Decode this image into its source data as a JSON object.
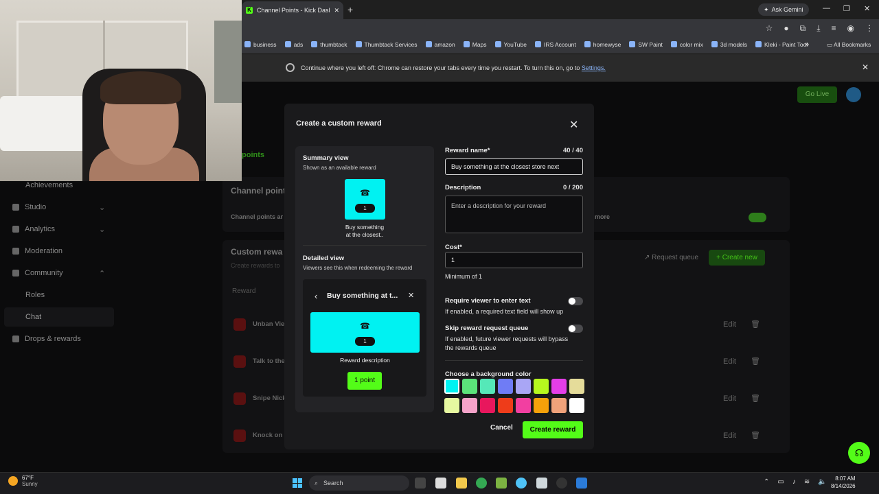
{
  "browser": {
    "tab_title": "Channel Points - Kick Dashboard",
    "new_tab": "+",
    "ask_gemini": "Ask Gemini",
    "bookmarks": [
      "business",
      "ads",
      "thumbtack",
      "Thumbtack Services",
      "amazon",
      "Maps",
      "YouTube",
      "IRS Account",
      "homewyse",
      "SW Paint",
      "color mix",
      "3d models",
      "Kleki - Paint Tool"
    ],
    "bookmarks_more": "»",
    "all_bookmarks": "All Bookmarks",
    "restore_text": "Continue where you left off: Chrome can restore your tabs every time you restart. To turn this on, go to",
    "restore_link": "Settings."
  },
  "dashboard": {
    "go_live": "Go Live",
    "points_tab": "points",
    "nav": [
      "Achievements",
      "Studio",
      "Analytics",
      "Moderation",
      "Community",
      "Roles",
      "Chat",
      "Drops & rewards"
    ],
    "channel_points_heading": "Channel point",
    "channel_points_desc": "Channel points ar",
    "more_link": "more",
    "custom_rewards_heading": "Custom rewa",
    "custom_rewards_desc": "Create rewards to",
    "request_queue": "Request queue",
    "create_new": "Create new",
    "col_reward": "Reward",
    "rows": [
      "Unban Vie",
      "Talk to the",
      "Snipe Nick",
      "Knock on I"
    ],
    "edit_label": "Edit"
  },
  "modal": {
    "title": "Create a custom reward",
    "summary_title": "Summary view",
    "summary_sub": "Shown as an available reward",
    "summary_cost": "1",
    "summary_name_1": "Buy something",
    "summary_name_2": "at the closest..",
    "detailed_title": "Detailed view",
    "detailed_sub": "Viewers see this when redeeming the reward",
    "detail_header": "Buy something at t...",
    "detail_cost": "1",
    "reward_description": "Reward description",
    "points_button": "1 point",
    "reward_name_label": "Reward name*",
    "reward_name_count": "40 / 40",
    "reward_name_value": "Buy something at the closest store next",
    "description_label": "Description",
    "description_count": "0 / 200",
    "description_placeholder": "Enter a description for your reward",
    "cost_label": "Cost*",
    "cost_value": "1",
    "cost_min": "Minimum of 1",
    "require_text_label": "Require viewer to enter text",
    "require_text_hint": "If enabled, a required text field will show up",
    "skip_queue_label": "Skip reward request queue",
    "skip_queue_hint_1": "If enabled, future viewer requests will bypass",
    "skip_queue_hint_2": "the rewards queue",
    "color_label": "Choose a background color",
    "colors_row1": [
      "#00f2f2",
      "#5be37a",
      "#55e8b8",
      "#6f7cf5",
      "#a9a6f5",
      "#b6f71e",
      "#e43ee8",
      "#e5dc9a"
    ],
    "colors_row2": [
      "#e6f8a0",
      "#f4a3c9",
      "#e8175d",
      "#ee3c1a",
      "#f23fa1",
      "#f5a10a",
      "#f0a27a",
      "#ffffff"
    ],
    "cancel": "Cancel",
    "create": "Create reward"
  },
  "taskbar": {
    "temp": "67°F",
    "condition": "Sunny",
    "search": "Search",
    "time": "8:07 AM",
    "date": "8/14/2026"
  }
}
